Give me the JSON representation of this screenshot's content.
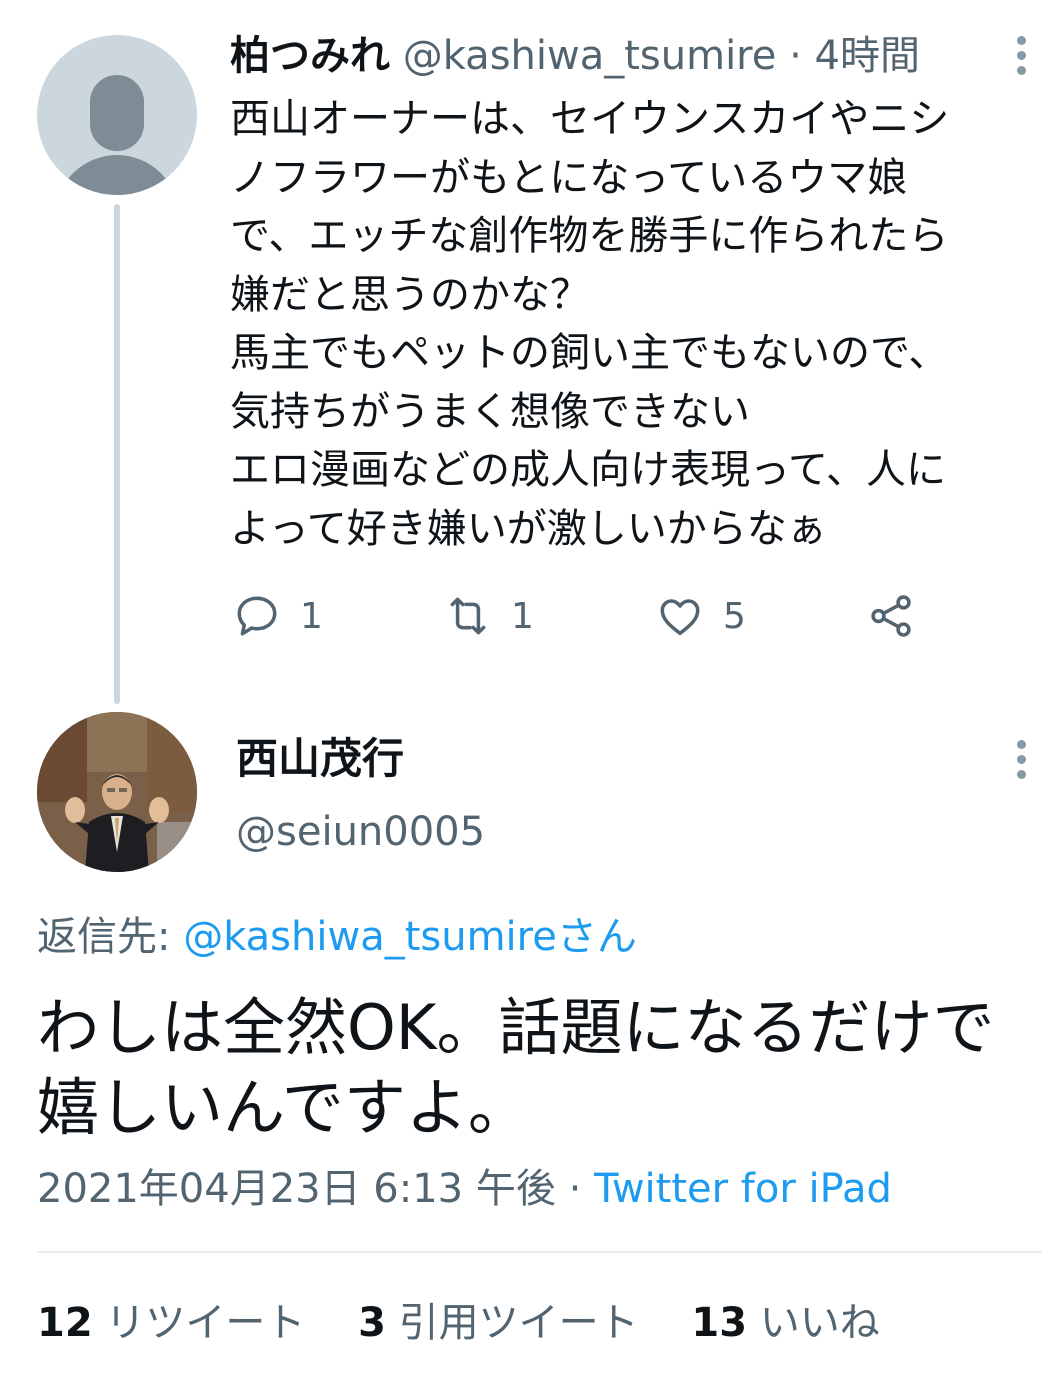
{
  "parent_tweet": {
    "display_name": "柏つみれ",
    "handle": "@kashiwa_tsumire",
    "separator": "·",
    "time": "4時間",
    "text": "西山オーナーは、セイウンスカイやニシ\nノフラワーがもとになっているウマ娘\nで、エッチな創作物を勝手に作られたら\n嫌だと思うのかな？\n馬主でもペットの飼い主でもないので、\n気持ちがうまく想像できない\nエロ漫画などの成人向け表現って、人に\nよって好き嫌いが激しいからなぁ",
    "reply_count": "1",
    "retweet_count": "1",
    "like_count": "5"
  },
  "main_tweet": {
    "display_name": "西山茂行",
    "handle": "@seiun0005",
    "reply_prefix": "返信先: ",
    "reply_to": "@kashiwa_tsumireさん",
    "text": "わしは全然OK。話題になるだけで\n嬉しいんですよ。",
    "timestamp": "2021年04月23日 6:13 午後",
    "separator": " · ",
    "source": "Twitter for iPad",
    "stats": {
      "retweets_value": "12",
      "retweets_label": "リツイート",
      "quotes_value": "3",
      "quotes_label": "引用ツイート",
      "likes_value": "13",
      "likes_label": "いいね"
    }
  },
  "colors": {
    "accent": "#1d9bf0",
    "muted_text": "#536471",
    "primary_text": "#0f1419",
    "thread_line": "#ccd6dd",
    "divider": "#e6ecf0"
  },
  "icons": [
    "default-avatar-icon",
    "more-options-icon",
    "reply-icon",
    "retweet-icon",
    "like-icon",
    "share-icon",
    "profile-photo"
  ]
}
